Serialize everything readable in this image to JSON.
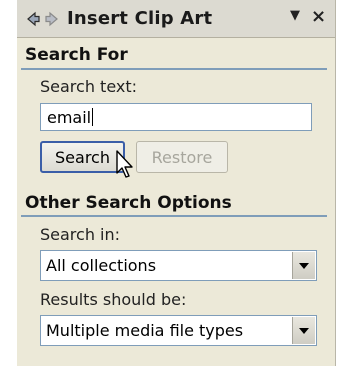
{
  "pane": {
    "title": "Insert Clip Art",
    "menu_glyph": "▼",
    "close_glyph": "×",
    "icons": [
      "back-arrow-icon",
      "forward-arrow-icon",
      "dropdown-menu-icon",
      "close-icon"
    ]
  },
  "search_for": {
    "heading": "Search For",
    "search_text_label": "Search text:",
    "search_text_value": "email",
    "search_button": "Search",
    "restore_button": "Restore"
  },
  "other_options": {
    "heading": "Other Search Options",
    "search_in_label": "Search in:",
    "search_in_value": "All collections",
    "results_label": "Results should be:",
    "results_value": "Multiple media file types"
  },
  "colors": {
    "pane_bg": "#ece9d8",
    "accent_rule": "#7f9db9",
    "button_focus_border": "#3a5ea8"
  }
}
